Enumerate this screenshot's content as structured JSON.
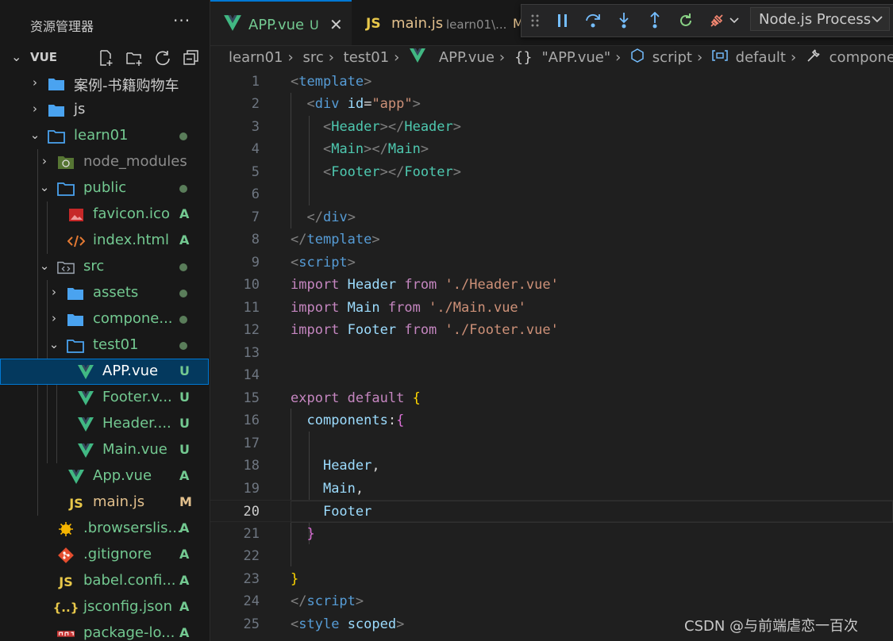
{
  "explorer": {
    "title": "资源管理器",
    "more": "···",
    "folder": "VUE"
  },
  "tree": [
    {
      "label": "案例-书籍购物车",
      "type": "folder",
      "expanded": false,
      "status": "",
      "color": "white"
    },
    {
      "label": "js",
      "type": "folder",
      "expanded": false,
      "status": "",
      "color": "white"
    },
    {
      "label": "learn01",
      "type": "folder-open",
      "expanded": true,
      "status": "dot",
      "color": "green"
    },
    {
      "label": "node_modules",
      "type": "node",
      "expanded": false,
      "status": "",
      "color": "gray"
    },
    {
      "label": "public",
      "type": "folder-open",
      "expanded": true,
      "status": "dot",
      "color": "green"
    },
    {
      "label": "favicon.ico",
      "type": "image",
      "status": "A",
      "color": "green"
    },
    {
      "label": "index.html",
      "type": "html",
      "status": "A",
      "color": "green"
    },
    {
      "label": "src",
      "type": "src",
      "expanded": true,
      "status": "dot",
      "color": "green"
    },
    {
      "label": "assets",
      "type": "folder",
      "expanded": false,
      "status": "dot",
      "color": "green"
    },
    {
      "label": "compone...",
      "type": "folder",
      "expanded": false,
      "status": "dot",
      "color": "green"
    },
    {
      "label": "test01",
      "type": "folder-open",
      "expanded": true,
      "status": "dot",
      "color": "green"
    },
    {
      "label": "APP.vue",
      "type": "vue",
      "status": "U",
      "color": "green",
      "selected": true
    },
    {
      "label": "Footer.v...",
      "type": "vue",
      "status": "U",
      "color": "green"
    },
    {
      "label": "Header....",
      "type": "vue",
      "status": "U",
      "color": "green"
    },
    {
      "label": "Main.vue",
      "type": "vue",
      "status": "U",
      "color": "green"
    },
    {
      "label": "App.vue",
      "type": "vue",
      "status": "A",
      "color": "green"
    },
    {
      "label": "main.js",
      "type": "js",
      "status": "M",
      "color": "orange"
    },
    {
      "label": ".browserslis...",
      "type": "browserslist",
      "status": "A",
      "color": "green"
    },
    {
      "label": ".gitignore",
      "type": "git",
      "status": "A",
      "color": "green"
    },
    {
      "label": "babel.confi...",
      "type": "js",
      "status": "A",
      "color": "green"
    },
    {
      "label": "jsconfig.json",
      "type": "json",
      "status": "A",
      "color": "green"
    },
    {
      "label": "package-lo...",
      "type": "npm",
      "status": "A",
      "color": "green"
    }
  ],
  "tabs": [
    {
      "label": "APP.vue",
      "status": "U",
      "active": true
    },
    {
      "label": "main.js",
      "desc": "learn01\\...",
      "status": "M",
      "active": false
    }
  ],
  "debug": {
    "process": "Node.js Process"
  },
  "breadcrumb": [
    "learn01",
    "src",
    "test01",
    "APP.vue",
    "\"APP.vue\"",
    "script",
    "default",
    "components"
  ],
  "code": {
    "current_line": 20,
    "line_numbers": [
      "1",
      "2",
      "3",
      "4",
      "5",
      "6",
      "7",
      "8",
      "9",
      "10",
      "11",
      "12",
      "13",
      "14",
      "15",
      "16",
      "17",
      "18",
      "19",
      "20",
      "21",
      "22",
      "23",
      "24",
      "25"
    ]
  },
  "watermark": "CSDN @与前端虐恋一百次"
}
